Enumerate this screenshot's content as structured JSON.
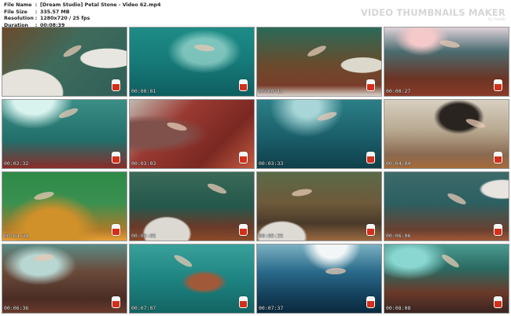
{
  "info": {
    "file_name_label": "File Name",
    "file_name": "[Dream Studio] Petal Stone - Video 62.mp4",
    "file_size_label": "File Size",
    "file_size": "335.57 MB",
    "resolution_label": "Resolution",
    "resolution": "1280x720 / 25 fps",
    "duration_label": "Duration",
    "duration": "00:08:39"
  },
  "brand": {
    "title": "VIDEO THUMBNAILS MAKER",
    "subtitle": "by Ivanik"
  },
  "thumbnails": [
    {
      "timestamp": "",
      "scene": "rocks-shore"
    },
    {
      "timestamp": "00:00:01",
      "scene": "open-water"
    },
    {
      "timestamp": "00:00:13",
      "scene": "reef-surface"
    },
    {
      "timestamp": "00:00:27",
      "scene": "swimmer-surface"
    },
    {
      "timestamp": "00:02:32",
      "scene": "under-light"
    },
    {
      "timestamp": "00:03:03",
      "scene": "red-reef-close"
    },
    {
      "timestamp": "00:03:33",
      "scene": "deep-blue"
    },
    {
      "timestamp": "00:04:04",
      "scene": "cave-rock"
    },
    {
      "timestamp": "00:04:34",
      "scene": "green-algae"
    },
    {
      "timestamp": "00:05:05",
      "scene": "diver-descent"
    },
    {
      "timestamp": "00:05:35",
      "scene": "shallow-reef"
    },
    {
      "timestamp": "00:06:06",
      "scene": "surface-swim"
    },
    {
      "timestamp": "00:06:36",
      "scene": "reef-close-fins"
    },
    {
      "timestamp": "00:07:07",
      "scene": "twist-blue"
    },
    {
      "timestamp": "00:07:37",
      "scene": "dark-blue-swim"
    },
    {
      "timestamp": "00:08:08",
      "scene": "reef-swim-end"
    }
  ]
}
